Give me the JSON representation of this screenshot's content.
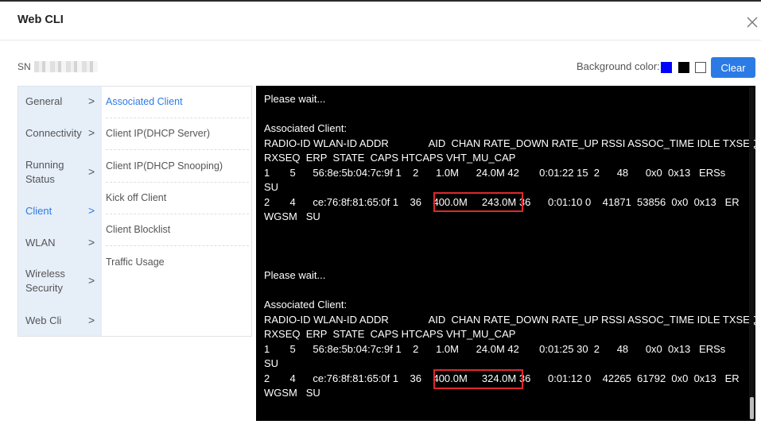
{
  "window": {
    "title": "Web CLI"
  },
  "sn": {
    "label": "SN"
  },
  "toolbar": {
    "background_label": "Background color:",
    "clear_label": "Clear"
  },
  "swatches": {
    "blue": "#0000ff",
    "black": "#000000",
    "white": "#ffffff"
  },
  "accent": "#2c7be5",
  "menu": {
    "categories": [
      {
        "label": "General",
        "chevron": ">"
      },
      {
        "label": "Connectivity",
        "chevron": ">"
      },
      {
        "label": "Running Status",
        "chevron": ">"
      },
      {
        "label": "Client",
        "chevron": ">"
      },
      {
        "label": "WLAN",
        "chevron": ">"
      },
      {
        "label": "Wireless Security",
        "chevron": ">"
      },
      {
        "label": "Web Cli",
        "chevron": ">"
      }
    ],
    "subitems": [
      {
        "label": "Associated Client"
      },
      {
        "label": "Client IP(DHCP Server)"
      },
      {
        "label": "Client IP(DHCP Snooping)"
      },
      {
        "label": "Kick off Client"
      },
      {
        "label": "Client Blocklist"
      },
      {
        "label": "Traffic Usage"
      }
    ]
  },
  "terminal": {
    "output": "Please wait...\n\nAssociated Client:\nRADIO-ID WLAN-ID ADDR              AID  CHAN RATE_DOWN RATE_UP RSSI ASSOC_TIME IDLE TXSEQ\nRXSEQ  ERP  STATE  CAPS HTCAPS VHT_MU_CAP\n1       5      56:8e:5b:04:7c:9f 1    2      1.0M      24.0M 42       0:01:22 15  2      48      0x0  0x13   ERSs\nSU\n2       4      ce:76:8f:81:65:0f 1    36    400.0M     243.0M 36      0:01:10 0    41871  53856  0x0  0x13   ER\nWGSM   SU\n\n\n\nPlease wait...\n\nAssociated Client:\nRADIO-ID WLAN-ID ADDR              AID  CHAN RATE_DOWN RATE_UP RSSI ASSOC_TIME IDLE TXSEQ\nRXSEQ  ERP  STATE  CAPS HTCAPS VHT_MU_CAP\n1       5      56:8e:5b:04:7c:9f 1    2      1.0M      24.0M 42       0:01:25 30  2      48      0x0  0x13   ERSs\nSU\n2       4      ce:76:8f:81:65:0f 1    36    400.0M     324.0M 36      0:01:12 0    42265  61792  0x0  0x13   ER\nWGSM   SU"
  }
}
